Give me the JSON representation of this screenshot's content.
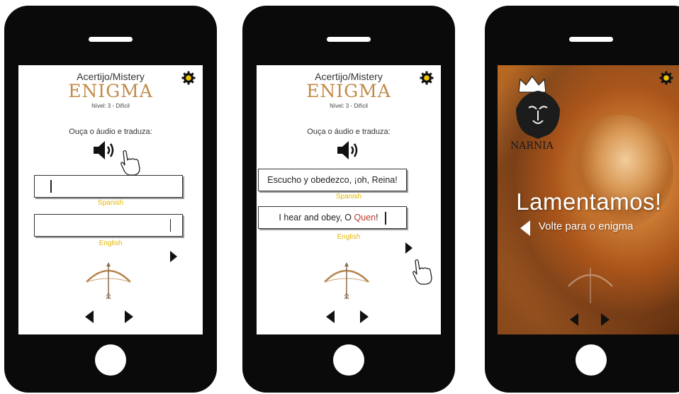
{
  "screens": [
    {
      "title": "Acertijo/Mistery",
      "brand": "ENIGMA",
      "level": "Nível: 3 - Difícil",
      "instruction": "Ouça o áudio e traduza:",
      "spanish_value": "",
      "spanish_label": "Spanish",
      "english_value": "",
      "english_label": "English"
    },
    {
      "title": "Acertijo/Mistery",
      "brand": "ENIGMA",
      "level": "Nível: 3 - Difícil",
      "instruction": "Ouça o áudio e traduza:",
      "spanish_value": "Escucho y obedezco, ¡oh, Reina!",
      "spanish_label": "Spanish",
      "english_value_prefix": "I hear and obey, O ",
      "english_value_error": "Quen",
      "english_value_suffix": "!",
      "english_label": "English"
    },
    {
      "logo_text": "NARNIA",
      "message": "Lamentamos!",
      "back_link": "Volte para o enigma"
    }
  ],
  "colors": {
    "brand": "#c28a48",
    "field_label": "#e6b800",
    "error": "#c0392b"
  },
  "icons": [
    "gear-icon",
    "speaker-icon",
    "hand-pointer-icon",
    "next-arrow-icon",
    "bow-arrow-icon",
    "prev-icon",
    "next-icon",
    "crown-icon",
    "lion-logo-icon"
  ]
}
